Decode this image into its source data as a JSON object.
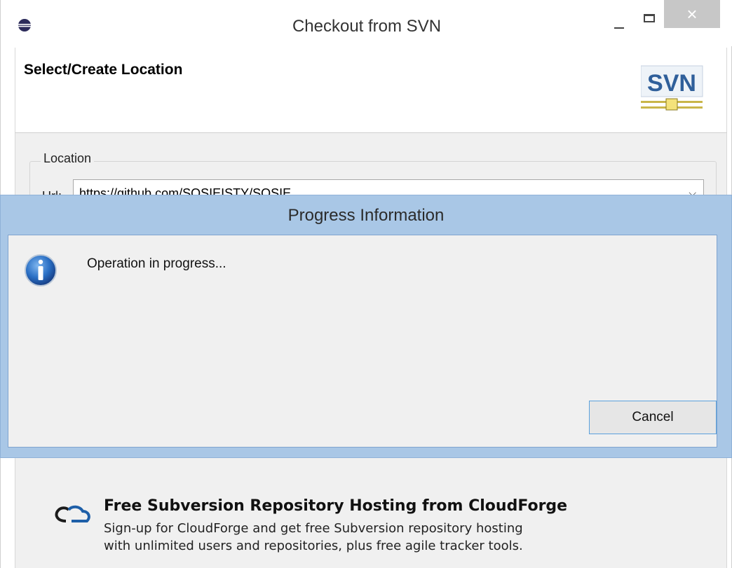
{
  "window": {
    "title": "Checkout from SVN",
    "close_glyph": "×"
  },
  "wizard": {
    "title": "Select/Create Location",
    "logo_text": "SVN",
    "location_group": {
      "legend": "Location",
      "url_label": "Url:",
      "url_value": "https://github.com/SOSIEISTY/SOSIE"
    },
    "cloudforge": {
      "heading": "Free Subversion Repository Hosting from CloudForge",
      "line1": "Sign-up for CloudForge and get free Subversion repository hosting",
      "line2": "with unlimited users and repositories, plus free agile tracker tools."
    }
  },
  "progress_dialog": {
    "title": "Progress Information",
    "message": "Operation in progress...",
    "cancel_label": "Cancel"
  },
  "colors": {
    "dialog_frame": "#a9c7e6",
    "client_bg": "#f0f0f0",
    "button_border": "#5aa0dc"
  },
  "icons": {
    "app": "eclipse-icon",
    "info": "info-icon",
    "logo": "svn-logo",
    "cloudforge": "cloudforge-icon"
  }
}
